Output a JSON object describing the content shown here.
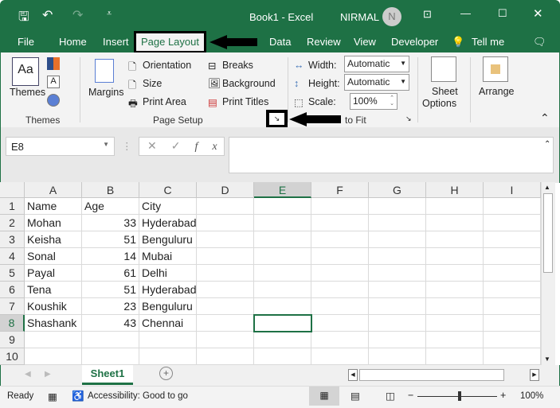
{
  "window": {
    "title": "Book1  -  Excel",
    "user": "NIRMAL",
    "avatar_initial": "N"
  },
  "tabs": [
    "File",
    "Home",
    "Insert",
    "Page Layout",
    "Data",
    "Review",
    "View",
    "Developer",
    "Tell me"
  ],
  "active_tab": "Page Layout",
  "ribbon": {
    "themes": {
      "label": "Themes",
      "group": "Themes"
    },
    "page_setup": {
      "margins": "Margins",
      "orientation": "Orientation",
      "size": "Size",
      "print_area": "Print Area",
      "breaks": "Breaks",
      "background": "Background",
      "print_titles": "Print Titles",
      "group": "Page Setup"
    },
    "scale_to_fit": {
      "width_label": "Width:",
      "width_value": "Automatic",
      "height_label": "Height:",
      "height_value": "Automatic",
      "scale_label": "Scale:",
      "scale_value": "100%",
      "group": "to Fit"
    },
    "sheet_options": {
      "line1": "Sheet",
      "line2": "Options"
    },
    "arrange": {
      "label": "Arrange"
    }
  },
  "formula_bar": {
    "name_box": "E8",
    "formula": ""
  },
  "columns": [
    "A",
    "B",
    "C",
    "D",
    "E",
    "F",
    "G",
    "H",
    "I"
  ],
  "rows": [
    [
      "Name",
      "Age",
      "City"
    ],
    [
      "Mohan",
      "33",
      "Hyderabad"
    ],
    [
      "Keisha",
      "51",
      "Benguluru"
    ],
    [
      "Sonal",
      "14",
      "Mubai"
    ],
    [
      "Payal",
      "61",
      "Delhi"
    ],
    [
      "Tena",
      "51",
      "Hyderabad"
    ],
    [
      "Koushik",
      "23",
      "Benguluru"
    ],
    [
      "Shashank",
      "43",
      "Chennai"
    ],
    [],
    []
  ],
  "selected_cell": "E8",
  "sheet_tabs": [
    "Sheet1"
  ],
  "status": {
    "ready": "Ready",
    "accessibility": "Accessibility: Good to go",
    "zoom": "100%"
  },
  "colors": {
    "brand": "#1e7145",
    "highlight": "#217346"
  }
}
